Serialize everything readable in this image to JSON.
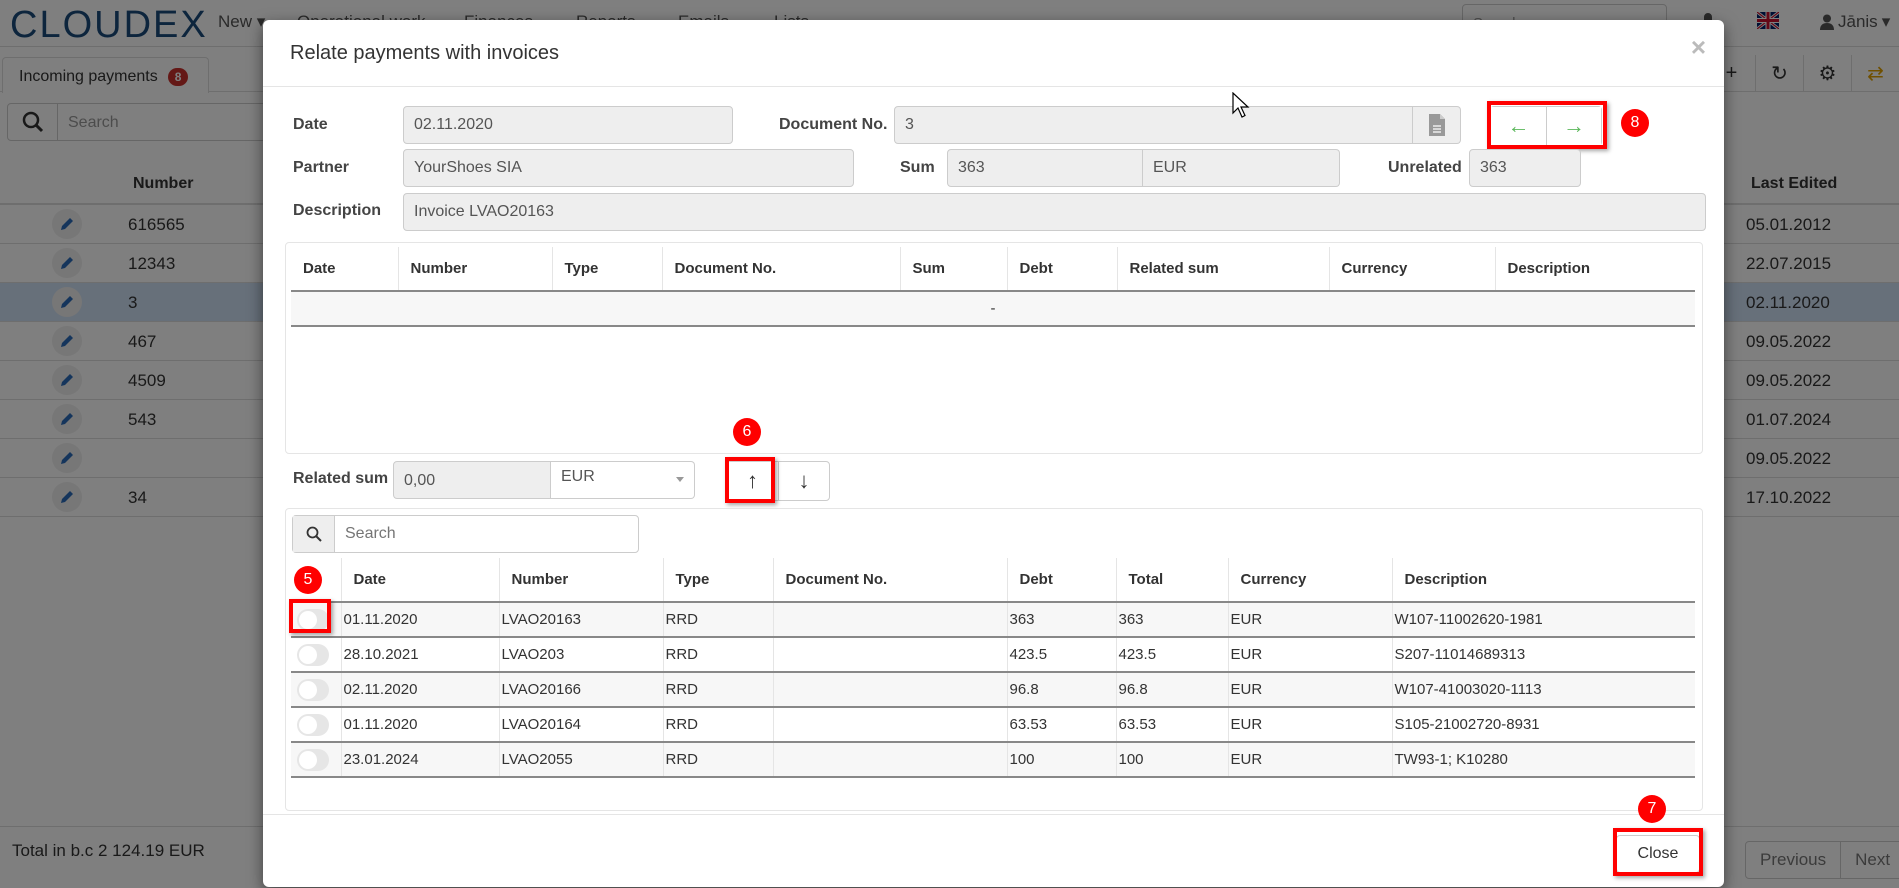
{
  "app": {
    "logo": "CLOUDEX",
    "nav": [
      "New",
      "Operational work",
      "Finances",
      "Reports",
      "Emails",
      "Lists"
    ],
    "nav_new_has_caret": true,
    "search_placeholder": "Search",
    "user": "Jānis",
    "language_icon": "uk-flag-icon"
  },
  "tabbar": {
    "tab_label": "Incoming payments",
    "tab_badge": "8",
    "toolbar_icons": [
      "plus-icon",
      "refresh-icon",
      "gear-icon",
      "swap-icon"
    ]
  },
  "background_list": {
    "search_placeholder": "Search",
    "columns": {
      "number": "Number",
      "last_edited": "Last Edited"
    },
    "rows": [
      {
        "number": "616565",
        "last_edited": "05.01.2012",
        "selected": false
      },
      {
        "number": "12343",
        "last_edited": "22.07.2015",
        "selected": false
      },
      {
        "number": "3",
        "last_edited": "02.11.2020",
        "selected": true
      },
      {
        "number": "467",
        "last_edited": "09.05.2022",
        "selected": false
      },
      {
        "number": "4509",
        "last_edited": "09.05.2022",
        "selected": false
      },
      {
        "number": "543",
        "last_edited": "01.07.2024",
        "selected": false
      },
      {
        "number": "",
        "last_edited": "09.05.2022",
        "selected": false
      },
      {
        "number": "34",
        "last_edited": "17.10.2022",
        "selected": false
      }
    ],
    "total": "Total in b.c 2 124.19 EUR",
    "pager": {
      "previous": "Previous",
      "next": "Next"
    }
  },
  "modal": {
    "title": "Relate payments with invoices",
    "close_x": "×",
    "form": {
      "date_label": "Date",
      "date_value": "02.11.2020",
      "docno_label": "Document No.",
      "docno_value": "3",
      "partner_label": "Partner",
      "partner_value": "YourShoes SIA",
      "sum_label": "Sum",
      "sum_value": "363",
      "sum_currency": "EUR",
      "unrelated_label": "Unrelated",
      "unrelated_value": "363",
      "description_label": "Description",
      "description_value": "Invoice LVAO20163"
    },
    "related_table": {
      "columns": [
        "Date",
        "Number",
        "Type",
        "Document No.",
        "Sum",
        "Debt",
        "Related sum",
        "Currency",
        "Description"
      ],
      "empty_text": "-"
    },
    "related_sum": {
      "label": "Related sum",
      "value": "0,00",
      "currency": "EUR"
    },
    "invoice_search_placeholder": "Search",
    "invoice_table": {
      "columns": [
        "Date",
        "Number",
        "Type",
        "Document No.",
        "Debt",
        "Total",
        "Currency",
        "Description"
      ],
      "rows": [
        {
          "date": "01.11.2020",
          "number": "LVAO20163",
          "type": "RRD",
          "docno": "",
          "debt": "363",
          "total": "363",
          "currency": "EUR",
          "description": "W107-11002620-1981",
          "checked": false
        },
        {
          "date": "28.10.2021",
          "number": "LVAO203",
          "type": "RRD",
          "docno": "",
          "debt": "423.5",
          "total": "423.5",
          "currency": "EUR",
          "description": "S207-11014689313",
          "checked": false
        },
        {
          "date": "02.11.2020",
          "number": "LVAO20166",
          "type": "RRD",
          "docno": "",
          "debt": "96.8",
          "total": "96.8",
          "currency": "EUR",
          "description": "W107-41003020-1113",
          "checked": false
        },
        {
          "date": "01.11.2020",
          "number": "LVAO20164",
          "type": "RRD",
          "docno": "",
          "debt": "63.53",
          "total": "63.53",
          "currency": "EUR",
          "description": "S105-21002720-8931",
          "checked": false
        },
        {
          "date": "23.01.2024",
          "number": "LVAO2055",
          "type": "RRD",
          "docno": "",
          "debt": "100",
          "total": "100",
          "currency": "EUR",
          "description": "TW93-1; K10280",
          "checked": false
        }
      ]
    },
    "close_button": "Close"
  },
  "annotations": {
    "marker_5": "5",
    "marker_6": "6",
    "marker_7": "7",
    "marker_8": "8",
    "highlight_color": "#ff0000"
  },
  "colors": {
    "nav_arrow": "#5cb85c",
    "badge": "#c9302c",
    "swap_icon": "#e0a000",
    "logo": "#1a4a7a"
  }
}
